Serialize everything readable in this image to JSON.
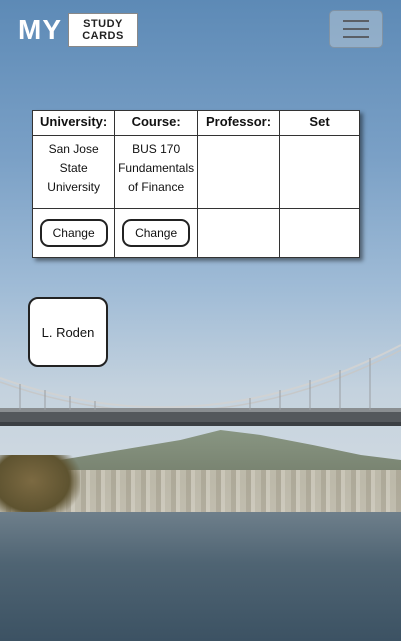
{
  "header": {
    "logo_my": "MY",
    "logo_line1": "STUDY",
    "logo_line2": "CARDS",
    "menu_icon": "hamburger-menu-icon"
  },
  "table": {
    "headers": [
      "University:",
      "Course:",
      "Professor:",
      "Set"
    ],
    "university": {
      "line1": "San Jose State",
      "line2": "University"
    },
    "course": {
      "line1": "BUS 170",
      "line2": "Fundamentals",
      "line3": "of Finance"
    },
    "change_label": "Change"
  },
  "professor_option": "L. Roden"
}
